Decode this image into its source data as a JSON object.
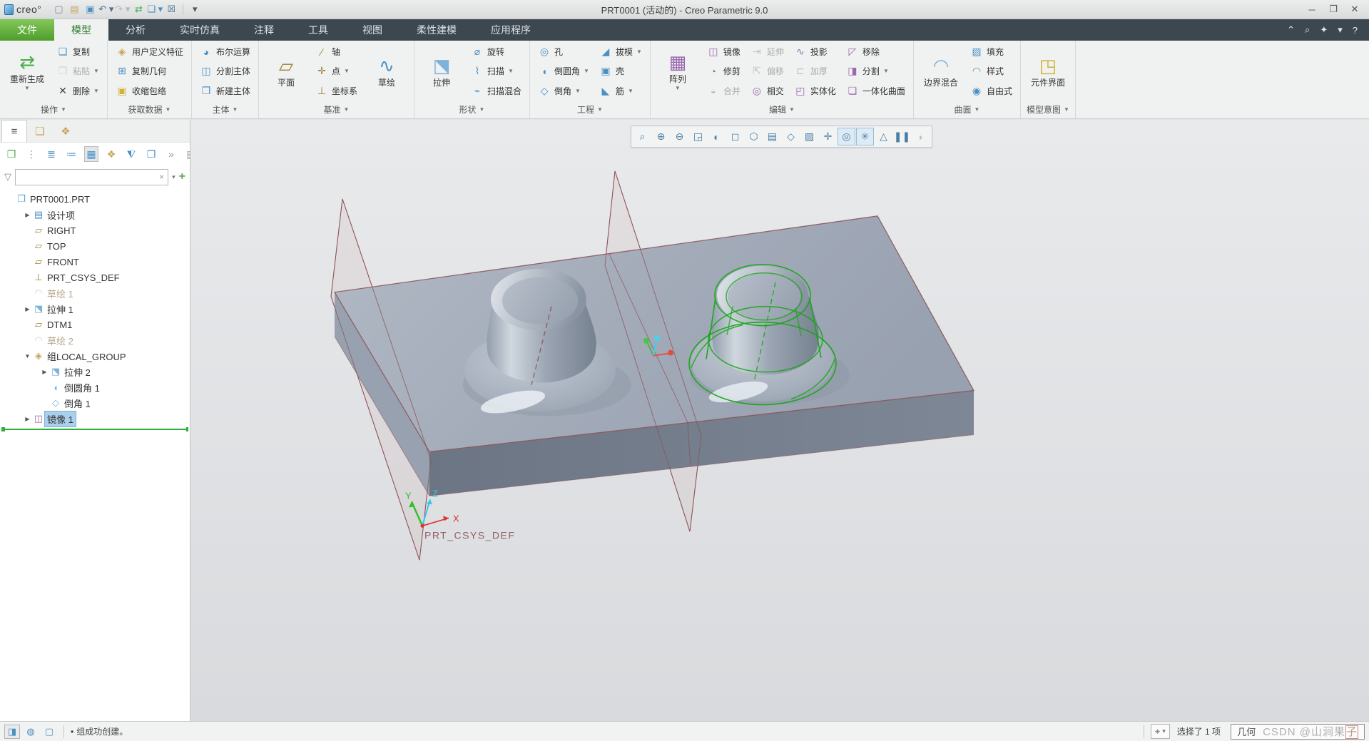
{
  "window": {
    "title": "PRT0001 (活动的) - Creo Parametric 9.0",
    "logo": "creo°",
    "controls": [
      {
        "name": "minimize-button",
        "glyph": "─"
      },
      {
        "name": "restore-button",
        "glyph": "❐"
      },
      {
        "name": "close-button",
        "glyph": "✕"
      }
    ]
  },
  "qat": {
    "icons": [
      {
        "name": "new-file-icon",
        "glyph": "▢",
        "color": "#7a8a98"
      },
      {
        "name": "open-file-icon",
        "glyph": "▤",
        "color": "#c9a45a"
      },
      {
        "name": "save-icon",
        "glyph": "▣",
        "color": "#4a90c4"
      },
      {
        "name": "undo-icon",
        "glyph": "↶",
        "color": "#4a6f92",
        "dropdown": true
      },
      {
        "name": "redo-icon",
        "glyph": "↷",
        "color": "#4a6f92",
        "disabled": true,
        "dropdown": true
      },
      {
        "name": "regenerate-small-icon",
        "glyph": "⇄",
        "color": "#4aae4a"
      },
      {
        "name": "windows-icon",
        "glyph": "❏",
        "color": "#4a90c4",
        "dropdown": true
      },
      {
        "name": "close-window-icon",
        "glyph": "☒",
        "color": "#4a6f92"
      },
      {
        "name": "customize-qat-icon",
        "glyph": "▾",
        "color": "#555",
        "sep_before": true
      }
    ]
  },
  "tabs": {
    "items": [
      {
        "name": "file",
        "label": "文件",
        "accent": true
      },
      {
        "name": "model",
        "label": "模型",
        "active": true
      },
      {
        "name": "analysis",
        "label": "分析"
      },
      {
        "name": "live-simulation",
        "label": "实时仿真"
      },
      {
        "name": "annotate",
        "label": "注释"
      },
      {
        "name": "tools",
        "label": "工具"
      },
      {
        "name": "view",
        "label": "视图"
      },
      {
        "name": "flexible-modeling",
        "label": "柔性建模"
      },
      {
        "name": "applications",
        "label": "应用程序"
      }
    ],
    "right_icons": [
      {
        "name": "collapse-ribbon-icon",
        "glyph": "⌃"
      },
      {
        "name": "search-icon",
        "glyph": "⌕"
      },
      {
        "name": "learning-connector-icon",
        "glyph": "✦"
      },
      {
        "name": "learning-dropdown-icon",
        "glyph": "▾"
      },
      {
        "name": "help-icon",
        "glyph": "?"
      }
    ]
  },
  "ribbon": {
    "groups": [
      {
        "name": "operations",
        "label": "操作",
        "items": [
          {
            "type": "big",
            "name": "regenerate",
            "label": "重新生成",
            "glyph": "⇄",
            "color": "#4aae4a",
            "dropdown": true
          },
          {
            "type": "col",
            "buttons": [
              {
                "name": "copy",
                "label": "复制",
                "glyph": "❏",
                "color": "#4a90c4"
              },
              {
                "name": "paste",
                "label": "粘贴",
                "glyph": "❐",
                "color": "#c9a45a",
                "disabled": true,
                "dropdown": true
              },
              {
                "name": "delete",
                "label": "删除",
                "glyph": "✕",
                "color": "#444",
                "dropdown": true
              }
            ]
          }
        ]
      },
      {
        "name": "get-data",
        "label": "获取数据",
        "items": [
          {
            "type": "col",
            "buttons": [
              {
                "name": "user-defined-feature",
                "label": "用户定义特征",
                "glyph": "◈",
                "color": "#c9a45a"
              },
              {
                "name": "copy-geometry",
                "label": "复制几何",
                "glyph": "⊞",
                "color": "#4a90c4"
              },
              {
                "name": "shrinkwrap",
                "label": "收缩包络",
                "glyph": "▣",
                "color": "#d2b23a"
              }
            ]
          }
        ]
      },
      {
        "name": "body",
        "label": "主体",
        "items": [
          {
            "type": "col",
            "buttons": [
              {
                "name": "boolean-operations",
                "label": "布尔运算",
                "glyph": "◕",
                "color": "#4a90c4"
              },
              {
                "name": "split-body",
                "label": "分割主体",
                "glyph": "◫",
                "color": "#4a90c4"
              },
              {
                "name": "new-body",
                "label": "新建主体",
                "glyph": "❐",
                "color": "#4a90c4"
              }
            ]
          }
        ]
      },
      {
        "name": "datum",
        "label": "基准",
        "items": [
          {
            "type": "big",
            "name": "plane",
            "label": "平面",
            "glyph": "▱",
            "color": "#a08030"
          },
          {
            "type": "col",
            "buttons": [
              {
                "name": "axis",
                "label": "轴",
                "glyph": "∕",
                "color": "#a08030"
              },
              {
                "name": "point",
                "label": "点",
                "glyph": "✛",
                "color": "#a08030",
                "dropdown": true
              },
              {
                "name": "coordinate-system",
                "label": "坐标系",
                "glyph": "⊥",
                "color": "#a08030"
              }
            ]
          },
          {
            "type": "big",
            "name": "sketch",
            "label": "草绘",
            "glyph": "∿",
            "color": "#4a90c4"
          }
        ]
      },
      {
        "name": "shapes",
        "label": "形状",
        "items": [
          {
            "type": "big",
            "name": "extrude",
            "label": "拉伸",
            "glyph": "⬔",
            "color": "#7fb2d9"
          },
          {
            "type": "col",
            "buttons": [
              {
                "name": "revolve",
                "label": "旋转",
                "glyph": "⌀",
                "color": "#4a90c4"
              },
              {
                "name": "sweep",
                "label": "扫描",
                "glyph": "⌇",
                "color": "#4a90c4",
                "dropdown": true
              },
              {
                "name": "swept-blend",
                "label": "扫描混合",
                "glyph": "⌁",
                "color": "#4a90c4"
              }
            ]
          }
        ]
      },
      {
        "name": "engineering",
        "label": "工程",
        "items": [
          {
            "type": "col",
            "buttons": [
              {
                "name": "hole",
                "label": "孔",
                "glyph": "◎",
                "color": "#4a90c4"
              },
              {
                "name": "round",
                "label": "倒圆角",
                "glyph": "◖",
                "color": "#4a90c4",
                "dropdown": true
              },
              {
                "name": "chamfer",
                "label": "倒角",
                "glyph": "◇",
                "color": "#4a90c4",
                "dropdown": true
              }
            ]
          },
          {
            "type": "col",
            "buttons": [
              {
                "name": "draft",
                "label": "拔模",
                "glyph": "◢",
                "color": "#4a90c4",
                "dropdown": true
              },
              {
                "name": "shell",
                "label": "壳",
                "glyph": "▣",
                "color": "#4a90c4"
              },
              {
                "name": "rib",
                "label": "筋",
                "glyph": "◣",
                "color": "#4a90c4",
                "dropdown": true
              }
            ]
          }
        ]
      },
      {
        "name": "editing",
        "label": "编辑",
        "items": [
          {
            "type": "big",
            "name": "pattern",
            "label": "阵列",
            "glyph": "▦",
            "color": "#9a6ab0",
            "dropdown": true
          },
          {
            "type": "col",
            "buttons": [
              {
                "name": "mirror",
                "label": "镜像",
                "glyph": "◫",
                "color": "#9a6ab0"
              },
              {
                "name": "trim",
                "label": "修剪",
                "glyph": "◔",
                "color": "#9a6ab0"
              },
              {
                "name": "merge",
                "label": "合并",
                "glyph": "◒",
                "color": "#9a6ab0",
                "disabled": true
              }
            ]
          },
          {
            "type": "col",
            "buttons": [
              {
                "name": "extend",
                "label": "延伸",
                "glyph": "⇥",
                "color": "#9a6ab0",
                "disabled": true
              },
              {
                "name": "offset",
                "label": "偏移",
                "glyph": "⇱",
                "color": "#9a6ab0",
                "disabled": true
              },
              {
                "name": "intersect",
                "label": "相交",
                "glyph": "◎",
                "color": "#9a6ab0"
              }
            ]
          },
          {
            "type": "col",
            "buttons": [
              {
                "name": "project",
                "label": "投影",
                "glyph": "∿",
                "color": "#9a6ab0"
              },
              {
                "name": "thicken",
                "label": "加厚",
                "glyph": "⊏",
                "color": "#9a6ab0",
                "disabled": true
              },
              {
                "name": "solidify",
                "label": "实体化",
                "glyph": "◰",
                "color": "#9a6ab0"
              }
            ]
          },
          {
            "type": "col",
            "buttons": [
              {
                "name": "remove",
                "label": "移除",
                "glyph": "◸",
                "color": "#9a6ab0"
              },
              {
                "name": "divide",
                "label": "分割",
                "glyph": "◨",
                "color": "#9a6ab0",
                "dropdown": true
              },
              {
                "name": "unite-surface",
                "label": "一体化曲面",
                "glyph": "❏",
                "color": "#9a6ab0"
              }
            ]
          }
        ]
      },
      {
        "name": "surfaces",
        "label": "曲面",
        "items": [
          {
            "type": "big",
            "name": "boundary-blend",
            "label": "边界混合",
            "glyph": "◠",
            "color": "#7fb2d9"
          },
          {
            "type": "col",
            "buttons": [
              {
                "name": "fill",
                "label": "填充",
                "glyph": "▨",
                "color": "#4a90c4"
              },
              {
                "name": "style",
                "label": "样式",
                "glyph": "◠",
                "color": "#4a90c4"
              },
              {
                "name": "freestyle",
                "label": "自由式",
                "glyph": "◉",
                "color": "#4a90c4"
              }
            ]
          }
        ]
      },
      {
        "name": "model-intent",
        "label": "模型意图",
        "items": [
          {
            "type": "big",
            "name": "component-interface",
            "label": "元件界面",
            "glyph": "◳",
            "color": "#d2b23a"
          }
        ]
      }
    ]
  },
  "tree_panel": {
    "tabs": [
      {
        "name": "model-tree-tab-icon",
        "glyph": "≡",
        "active": true
      },
      {
        "name": "folder-browser-tab-icon",
        "glyph": "❏"
      },
      {
        "name": "favorites-tab-icon",
        "glyph": "❖"
      }
    ],
    "toolbar": [
      {
        "name": "show-icon",
        "glyph": "❒",
        "color": "#4aae4a"
      },
      {
        "name": "handle-icon",
        "glyph": "⋮",
        "plain": true
      },
      {
        "name": "expand-all-icon",
        "glyph": "≣"
      },
      {
        "name": "collapse-all-icon",
        "glyph": "≔"
      },
      {
        "name": "tree-columns-icon",
        "glyph": "▦",
        "pressed": true
      },
      {
        "name": "open-settings-icon",
        "glyph": "❖",
        "color": "#c9a45a"
      },
      {
        "name": "tree-filters-icon",
        "glyph": "⧨"
      },
      {
        "name": "column-display-icon",
        "glyph": "❐"
      },
      {
        "name": "overflow-icon",
        "glyph": "»",
        "plain": true
      },
      {
        "name": "tree-options-icon",
        "glyph": "▤",
        "plain": true
      }
    ],
    "filter": {
      "placeholder": "",
      "clear_glyph": "×",
      "dropdown_glyph": "▾",
      "add_glyph": "+"
    },
    "items": [
      {
        "name": "part-root",
        "label": "PRT0001.PRT",
        "glyph": "❒",
        "color": "#5aa7d4",
        "indent": 0
      },
      {
        "name": "design-items",
        "label": "设计项",
        "glyph": "▤",
        "color": "#4a90c4",
        "indent": 1,
        "arrow": "right"
      },
      {
        "name": "plane-right",
        "label": "RIGHT",
        "glyph": "▱",
        "color": "#a08030",
        "indent": 1
      },
      {
        "name": "plane-top",
        "label": "TOP",
        "glyph": "▱",
        "color": "#a08030",
        "indent": 1
      },
      {
        "name": "plane-front",
        "label": "FRONT",
        "glyph": "▱",
        "color": "#a08030",
        "indent": 1
      },
      {
        "name": "csys-def",
        "label": "PRT_CSYS_DEF",
        "glyph": "⊥",
        "color": "#a08030",
        "indent": 1
      },
      {
        "name": "sketch-1",
        "label": "草绘 1",
        "glyph": "◠",
        "color": "#b8ab8a",
        "indent": 1,
        "dimmed": true
      },
      {
        "name": "extrude-1",
        "label": "拉伸 1",
        "glyph": "⬔",
        "color": "#7fb2d9",
        "indent": 1,
        "arrow": "right"
      },
      {
        "name": "dtm1",
        "label": "DTM1",
        "glyph": "▱",
        "color": "#a08030",
        "indent": 1
      },
      {
        "name": "sketch-2",
        "label": "草绘 2",
        "glyph": "◠",
        "color": "#b8ab8a",
        "indent": 1,
        "dimmed": true
      },
      {
        "name": "group-local-group",
        "label": "组LOCAL_GROUP",
        "glyph": "◈",
        "color": "#c9a45a",
        "indent": 1,
        "arrow": "down"
      },
      {
        "name": "extrude-2",
        "label": "拉伸 2",
        "glyph": "⬔",
        "color": "#7fb2d9",
        "indent": 2,
        "arrow": "right"
      },
      {
        "name": "round-1",
        "label": "倒圆角 1",
        "glyph": "◖",
        "color": "#7fb2d9",
        "indent": 2
      },
      {
        "name": "chamfer-1",
        "label": "倒角 1",
        "glyph": "◇",
        "color": "#7fb2d9",
        "indent": 2
      },
      {
        "name": "mirror-1",
        "label": "镜像 1",
        "glyph": "◫",
        "color": "#9a6ab0",
        "indent": 1,
        "arrow": "right",
        "selected": true
      }
    ]
  },
  "gtoolbar": {
    "icons": [
      {
        "name": "zoom-region-icon",
        "glyph": "⌕"
      },
      {
        "name": "zoom-in-icon",
        "glyph": "⊕"
      },
      {
        "name": "zoom-out-icon",
        "glyph": "⊖"
      },
      {
        "name": "refit-icon",
        "glyph": "◲"
      },
      {
        "name": "appearance-icon",
        "glyph": "◐"
      },
      {
        "name": "display-style-icon",
        "glyph": "◻"
      },
      {
        "name": "saved-orientations-icon",
        "glyph": "⬡"
      },
      {
        "name": "capture-icon",
        "glyph": "▤"
      },
      {
        "name": "perspective-icon",
        "glyph": "◇"
      },
      {
        "name": "section-icon",
        "glyph": "▨"
      },
      {
        "name": "datum-display-icon",
        "glyph": "✛"
      },
      {
        "name": "annotation-display-icon",
        "glyph": "◎",
        "pressed": true
      },
      {
        "name": "spin-center-icon",
        "glyph": "✳",
        "pressed": true
      },
      {
        "name": "geometry-check-icon",
        "glyph": "△"
      },
      {
        "name": "pause-icon",
        "glyph": "❚❚"
      },
      {
        "name": "clip-icon",
        "glyph": "◗",
        "disabled": true
      }
    ]
  },
  "viewport": {
    "csys": {
      "label": "PRT_CSYS_DEF",
      "x": "X",
      "y": "Y",
      "z": "Z"
    }
  },
  "statusbar": {
    "left_icons": [
      {
        "name": "panel-toggle-icon",
        "glyph": "◨",
        "pressed": true
      },
      {
        "name": "web-browser-icon",
        "glyph": "◍"
      },
      {
        "name": "blank-panel-icon",
        "glyph": "▢"
      }
    ],
    "bullet": "•",
    "message": "组成功创建。",
    "binoculars_glyph": "⌖",
    "binoculars_dd": "▾",
    "selected_text": "选择了 1 项",
    "filter_value": "几何",
    "watermark": "CSDN @山涧果",
    "watermark_last": "子"
  }
}
